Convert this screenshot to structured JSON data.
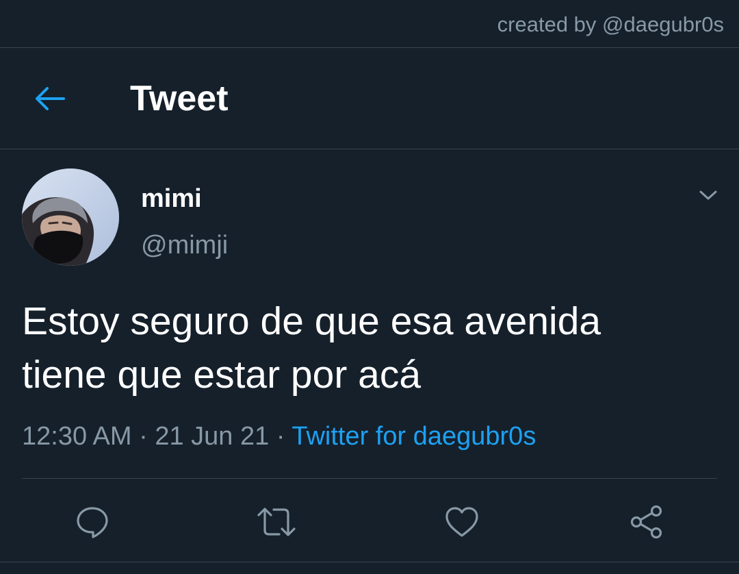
{
  "credit": "created by @daegubr0s",
  "header": {
    "title": "Tweet",
    "back_icon": "arrow-left-icon"
  },
  "tweet": {
    "author_name": "mimi",
    "author_handle": "@mimji",
    "text": "Estoy seguro de que esa avenida\ntiene que estar por acá",
    "time": "12:30 AM",
    "date": "21 Jun 21",
    "separator": "·",
    "source": "Twitter for daegubr0s"
  },
  "actions": [
    "reply-icon",
    "retweet-icon",
    "like-icon",
    "share-icon"
  ],
  "colors": {
    "background": "#15202b",
    "accent": "#1da1f2",
    "secondary_text": "#8899a6",
    "border": "#38444d"
  }
}
